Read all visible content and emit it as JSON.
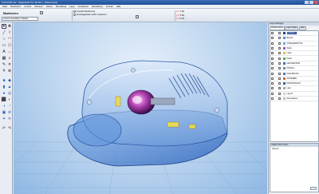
{
  "window": {
    "title": "ArchiCAD-Ver - MegaCAD Pro 3D Rev - [PlaneView]"
  },
  "menu": [
    "Datei",
    "Bearbeiten",
    "Ansicht",
    "Zeichnen",
    "Ebene",
    "Bemaßung",
    "Layer",
    "Funktionen",
    "Darstellung",
    "Fenster",
    "Hilfe"
  ],
  "toolbar": {
    "mode_label": "Markieren",
    "mode_select_value": "Ansicht auswählen Objekte",
    "opt1": "Auswahl-Markierung",
    "opt2": "Hinzufügbarkeit selbst markieren",
    "coords": [
      {
        "label": "x =",
        "value": "7.92"
      },
      {
        "label": "y =",
        "value": "3.83"
      },
      {
        "label": "z =",
        "value": "0.25"
      }
    ]
  },
  "right_panel": {
    "header": "Layer-Manager",
    "tabs": [
      "Projekt-Layers",
      "Layer-Folder",
      "Aktiv"
    ],
    "layers": [
      {
        "name": "Gehäuse",
        "color": "#1d3f8a",
        "selected": true
      },
      {
        "name": "Bauteil",
        "color": "#4a8fd4"
      },
      {
        "name": "TORQUEMOTOR",
        "color": "#6aa6e0"
      },
      {
        "name": "Welle",
        "color": "#9c5bb5"
      },
      {
        "name": "Lüfter",
        "color": "#e0c040"
      },
      {
        "name": "Kabel",
        "color": "#55aa55"
      },
      {
        "name": "GRUNDFORM",
        "color": "#3a6fb7"
      },
      {
        "name": "INSTALL",
        "color": "#7c8aa0"
      },
      {
        "name": "HALTERUNG",
        "color": "#5577aa"
      },
      {
        "name": "ANTRIEBE",
        "color": "#c07030"
      },
      {
        "name": "PROFILBLECH",
        "color": "#3a5f90"
      },
      {
        "name": "Lack",
        "color": "#aaaaaa"
      },
      {
        "name": "Layer1",
        "color": "#d0d0d0"
      },
      {
        "name": "Dach-Ebene",
        "color": "#bbbbbb"
      }
    ],
    "info_header": "Objekt-Information",
    "info_text": "Volume:"
  },
  "icons": {
    "tool_select": "arrow-cursor-icon",
    "tool_line": "line-icon",
    "tool_rect": "rectangle-icon",
    "tool_circle": "circle-icon"
  }
}
